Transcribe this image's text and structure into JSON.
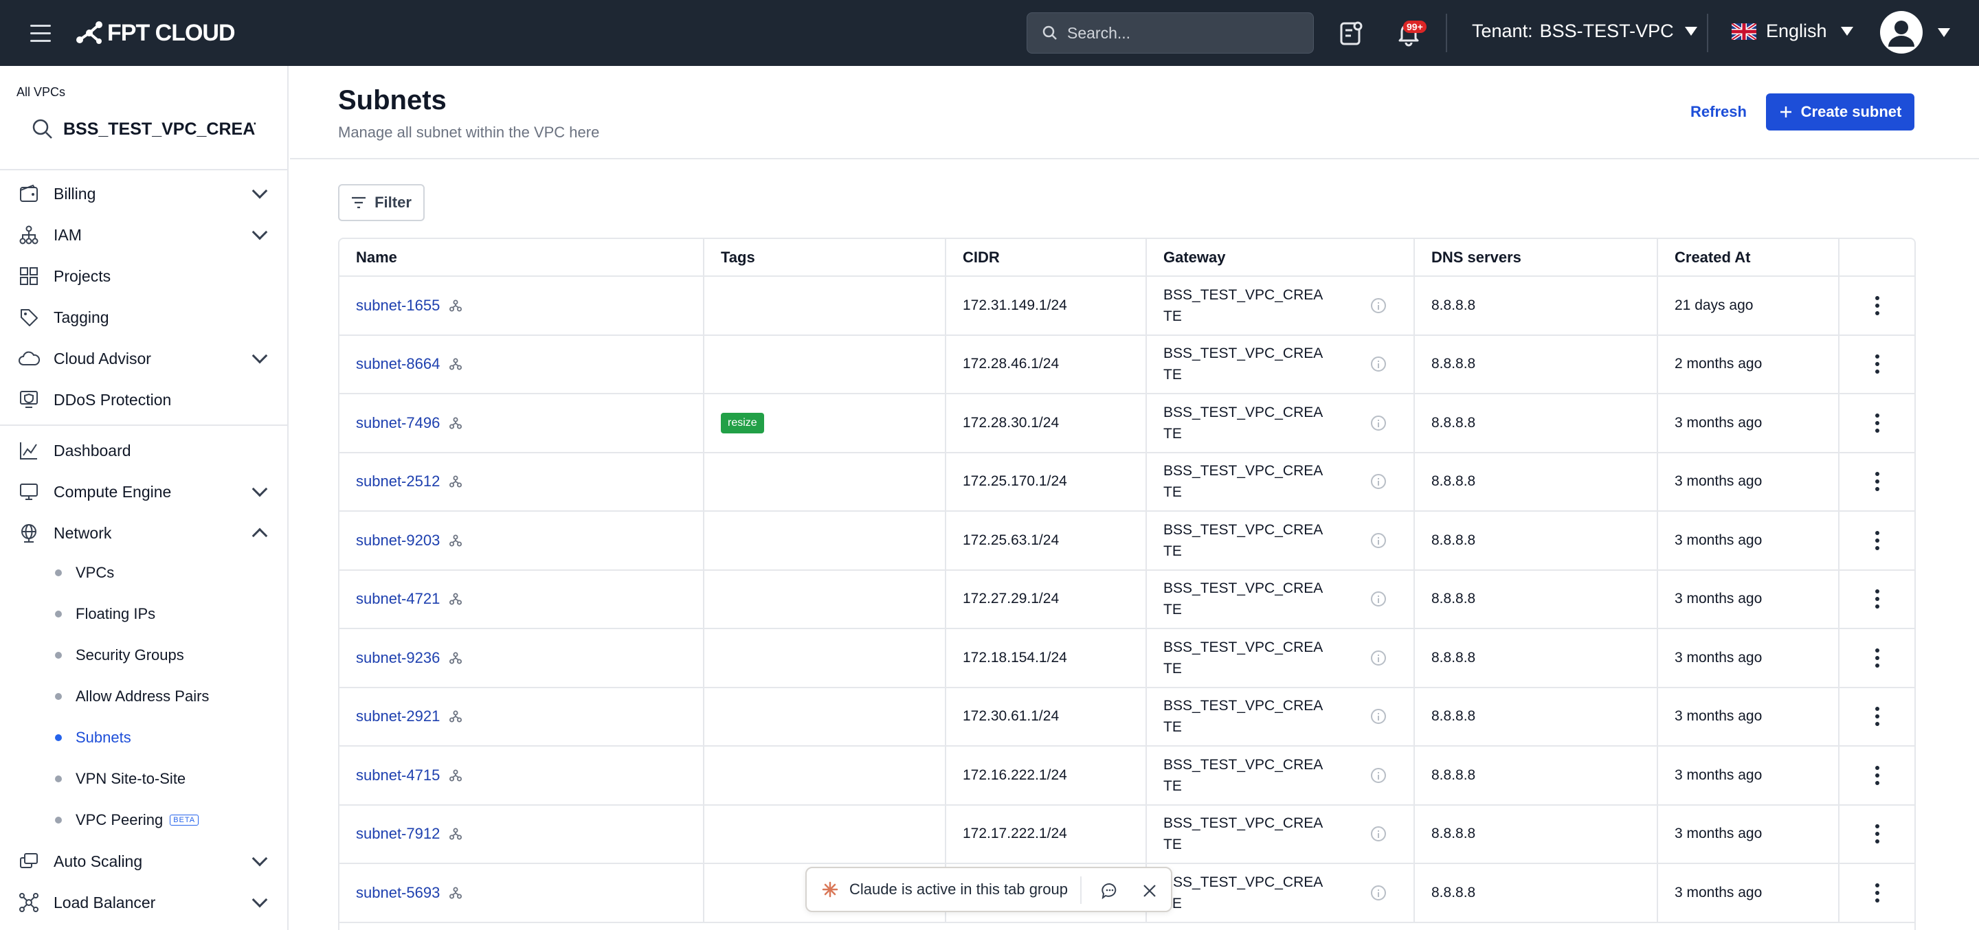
{
  "app": {
    "logo_text": "FPT CLOUD"
  },
  "topbar": {
    "search_placeholder": "Search...",
    "notification_badge": "99+",
    "tenant_label": "Tenant:",
    "tenant_value": "BSS-TEST-VPC",
    "language": "English"
  },
  "sidebar": {
    "vpc_label": "All VPCs",
    "vpc_value": "BSS_TEST_VPC_CREATE",
    "items": {
      "billing": "Billing",
      "iam": "IAM",
      "projects": "Projects",
      "tagging": "Tagging",
      "cloud_advisor": "Cloud Advisor",
      "ddos": "DDoS Protection",
      "dashboard": "Dashboard",
      "compute": "Compute Engine",
      "network": "Network",
      "auto_scaling": "Auto Scaling",
      "load_balancer": "Load Balancer"
    },
    "network_sub": {
      "vpcs": "VPCs",
      "floating_ips": "Floating IPs",
      "security_groups": "Security Groups",
      "allow_address_pairs": "Allow Address Pairs",
      "subnets": "Subnets",
      "vpn": "VPN Site-to-Site",
      "vpc_peering": "VPC Peering",
      "beta_badge": "BETA"
    }
  },
  "main": {
    "title": "Subnets",
    "subtitle": "Manage all subnet within the VPC here",
    "refresh_label": "Refresh",
    "create_label": "Create subnet",
    "filter_label": "Filter"
  },
  "table": {
    "headers": {
      "name": "Name",
      "tags": "Tags",
      "cidr": "CIDR",
      "gateway": "Gateway",
      "dns": "DNS servers",
      "created": "Created At"
    },
    "rows": [
      {
        "name": "subnet-1655",
        "tag": "",
        "cidr": "172.31.149.1/24",
        "gateway": "BSS_TEST_VPC_CREATE",
        "dns": "8.8.8.8",
        "created": "21 days ago"
      },
      {
        "name": "subnet-8664",
        "tag": "",
        "cidr": "172.28.46.1/24",
        "gateway": "BSS_TEST_VPC_CREATE",
        "dns": "8.8.8.8",
        "created": "2 months ago"
      },
      {
        "name": "subnet-7496",
        "tag": "resize",
        "cidr": "172.28.30.1/24",
        "gateway": "BSS_TEST_VPC_CREATE",
        "dns": "8.8.8.8",
        "created": "3 months ago"
      },
      {
        "name": "subnet-2512",
        "tag": "",
        "cidr": "172.25.170.1/24",
        "gateway": "BSS_TEST_VPC_CREATE",
        "dns": "8.8.8.8",
        "created": "3 months ago"
      },
      {
        "name": "subnet-9203",
        "tag": "",
        "cidr": "172.25.63.1/24",
        "gateway": "BSS_TEST_VPC_CREATE",
        "dns": "8.8.8.8",
        "created": "3 months ago"
      },
      {
        "name": "subnet-4721",
        "tag": "",
        "cidr": "172.27.29.1/24",
        "gateway": "BSS_TEST_VPC_CREATE",
        "dns": "8.8.8.8",
        "created": "3 months ago"
      },
      {
        "name": "subnet-9236",
        "tag": "",
        "cidr": "172.18.154.1/24",
        "gateway": "BSS_TEST_VPC_CREATE",
        "dns": "8.8.8.8",
        "created": "3 months ago"
      },
      {
        "name": "subnet-2921",
        "tag": "",
        "cidr": "172.30.61.1/24",
        "gateway": "BSS_TEST_VPC_CREATE",
        "dns": "8.8.8.8",
        "created": "3 months ago"
      },
      {
        "name": "subnet-4715",
        "tag": "",
        "cidr": "172.16.222.1/24",
        "gateway": "BSS_TEST_VPC_CREATE",
        "dns": "8.8.8.8",
        "created": "3 months ago"
      },
      {
        "name": "subnet-7912",
        "tag": "",
        "cidr": "172.17.222.1/24",
        "gateway": "BSS_TEST_VPC_CREATE",
        "dns": "8.8.8.8",
        "created": "3 months ago"
      },
      {
        "name": "subnet-5693",
        "tag": "",
        "cidr": "",
        "gateway": "BSS_TEST_VPC_CREATE",
        "dns": "8.8.8.8",
        "created": "3 months ago"
      }
    ]
  },
  "toast": {
    "message": "Claude is active in this tab group"
  },
  "colors": {
    "topbar": "#1e2733",
    "accent": "#1d4ed8",
    "tag_green": "#22a047"
  }
}
